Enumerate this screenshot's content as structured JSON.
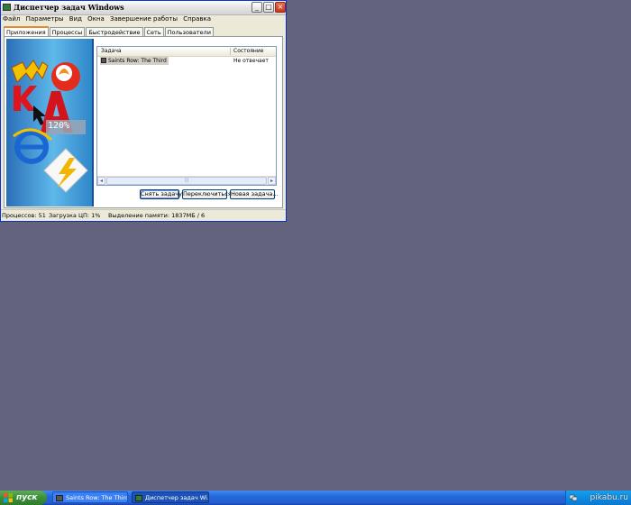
{
  "window": {
    "title": "Диспетчер задач Windows",
    "controls": [
      "_",
      "□",
      "×"
    ]
  },
  "menu": {
    "items": [
      "Файл",
      "Параметры",
      "Вид",
      "Окна",
      "Завершение работы",
      "Справка"
    ]
  },
  "tabs": {
    "items": [
      "Приложения",
      "Процессы",
      "Быстродействие",
      "Сеть",
      "Пользователи"
    ],
    "active": "Приложения"
  },
  "banner": {
    "overlay_text": "120%"
  },
  "applications": {
    "columns": [
      "Задача",
      "Состояние"
    ],
    "rows": [
      {
        "task": "Saints Row: The Third",
        "state": "Не отвечает"
      }
    ]
  },
  "buttons": {
    "end_task": "Снять задачу",
    "switch_to": "Переключиться",
    "new_task": "Новая задача..."
  },
  "status": {
    "processes": "Процессов: 51",
    "cpu": "Загрузка ЦП: 1%",
    "memory": "Выделение памяти: 1837МБ / 6"
  },
  "taskbar": {
    "start_label": "пуск",
    "tasks": [
      {
        "label": "Saints Row: The Third",
        "active": false
      },
      {
        "label": "Диспетчер задач Wi...",
        "active": true
      }
    ],
    "watermark": "pikabu.ru"
  },
  "colors": {
    "desktop": "#63637e",
    "window_border": "#0831d9",
    "taskbar": "#245dd5",
    "start_button": "#3c8f3a"
  }
}
